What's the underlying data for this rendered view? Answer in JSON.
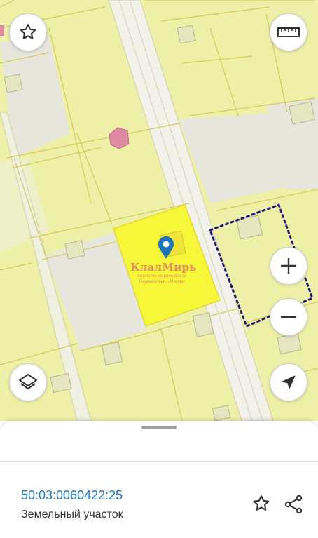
{
  "map": {
    "selected_color": "#f7f73a",
    "dotted_color": "#1f1a7a",
    "marker_color": "#1f74b8",
    "logo": {
      "title": "КлалМирь",
      "subtitle_line1": "Агентство недвижимости",
      "subtitle_line2": "Подмосковье и Москва"
    }
  },
  "controls": {
    "favorite_icon": "star-outline-icon",
    "ruler_icon": "ruler-icon",
    "zoom_in_icon": "plus-icon",
    "zoom_out_icon": "minus-icon",
    "layers_icon": "layers-icon",
    "locate_icon": "navigation-arrow-icon"
  },
  "sheet": {
    "cadastral_number": "50:03:0060422:25",
    "object_type": "Земельный участок",
    "accent_color": "#1f78c8"
  }
}
